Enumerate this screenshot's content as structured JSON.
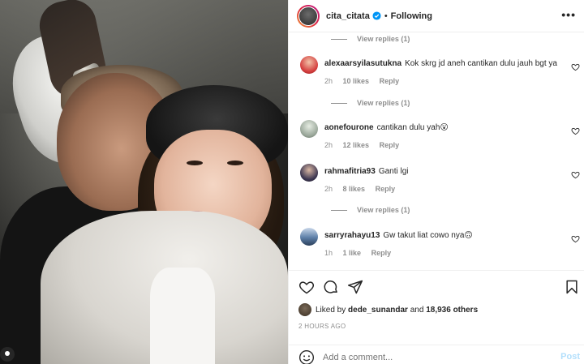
{
  "header": {
    "username": "cita_citata",
    "separator": "•",
    "follow_status": "Following"
  },
  "comments": [
    {
      "type": "replies",
      "label": "View replies (1)"
    },
    {
      "type": "comment",
      "username": "alexaarsyilasutukna",
      "text": "Kok skrg jd aneh cantikan dulu jauh bgt ya",
      "time": "2h",
      "likes": "10 likes",
      "reply": "Reply",
      "avatar_color": "#d43d3d"
    },
    {
      "type": "replies",
      "label": "View replies (1)"
    },
    {
      "type": "comment",
      "username": "aonefourone",
      "text": "cantikan dulu yah😮",
      "time": "2h",
      "likes": "12 likes",
      "reply": "Reply",
      "avatar_color": "#9aa79a"
    },
    {
      "type": "comment",
      "username": "rahmafitria93",
      "text": "Ganti lgi",
      "time": "2h",
      "likes": "8 likes",
      "reply": "Reply",
      "avatar_color": "#3b3550"
    },
    {
      "type": "replies",
      "label": "View replies (1)"
    },
    {
      "type": "comment",
      "username": "sarryrahayu13",
      "text": "Gw takut liat cowo nya🙃",
      "time": "1h",
      "likes": "1 like",
      "reply": "Reply",
      "avatar_color": "#5d7fa8"
    }
  ],
  "likes": {
    "prefix": "Liked by",
    "user": "dede_sunandar",
    "middle": "and",
    "others": "18,936 others"
  },
  "time_ago": "2 HOURS AGO",
  "add_comment": {
    "placeholder": "Add a comment...",
    "post_label": "Post"
  },
  "icons": [
    "verified-badge-icon",
    "more-options-icon",
    "heart-icon",
    "comment-icon",
    "share-icon",
    "save-bookmark-icon",
    "emoji-icon",
    "tag-user-icon"
  ],
  "colors": {
    "accent_blue": "#0095f6",
    "post_disabled": "#b2dffc",
    "muted_text": "#8e8e8e"
  }
}
